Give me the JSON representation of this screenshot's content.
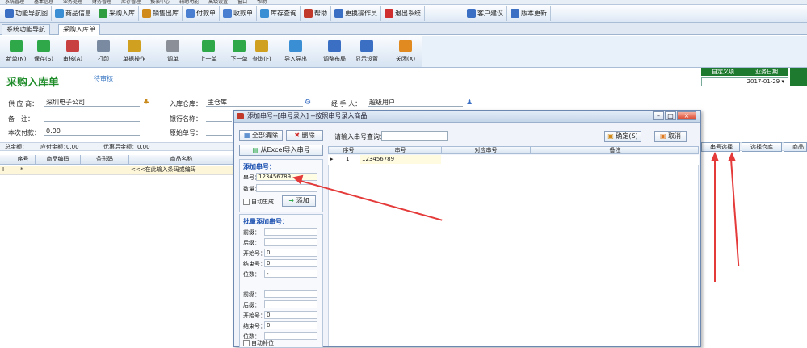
{
  "menubar": {
    "items": [
      "系统管理",
      "基本信息",
      "业务处理",
      "财务管理",
      "库存管理",
      "报表中心",
      "辅助功能",
      "高级设置",
      "窗口",
      "帮助"
    ]
  },
  "quickbar": {
    "items": [
      {
        "label": "功能导航图",
        "color": "#3a6fc4",
        "icon": "navigation-icon"
      },
      {
        "label": "商品信息",
        "color": "#3a8fd4",
        "icon": "product-icon"
      },
      {
        "label": "采购入库",
        "color": "#2f9e41",
        "icon": "purchase-icon"
      },
      {
        "label": "销售出库",
        "color": "#d08a1a",
        "icon": "sales-icon"
      },
      {
        "label": "付款单",
        "color": "#4a7ed0",
        "icon": "payment-icon"
      },
      {
        "label": "收款单",
        "color": "#4a7ed0",
        "icon": "receipt-icon"
      },
      {
        "label": "库存查询",
        "color": "#3a8fd4",
        "icon": "inventory-icon"
      },
      {
        "label": "帮助",
        "color": "#c0392b",
        "icon": "help-icon"
      },
      {
        "label": "更换操作员",
        "color": "#3a6fc4",
        "icon": "switch-user-icon"
      },
      {
        "label": "退出系统",
        "color": "#d02f2f",
        "icon": "exit-icon"
      },
      {
        "label": "客户建议",
        "color": "#3a6fc4",
        "icon": "feedback-icon"
      },
      {
        "label": "版本更新",
        "color": "#3a6fc4",
        "icon": "update-icon"
      }
    ]
  },
  "tabs": [
    {
      "label": "系统功能导航"
    },
    {
      "label": "采购入库单"
    }
  ],
  "toolbar": {
    "buttons": [
      {
        "label": "新单(N)",
        "color": "#2fa84a",
        "icon": "new-icon"
      },
      {
        "label": "保存(S)",
        "color": "#2fa84a",
        "icon": "save-icon"
      },
      {
        "label": "审核(A)",
        "color": "#c94040",
        "icon": "audit-icon"
      },
      {
        "label": "打印",
        "color": "#7a8aa0",
        "icon": "print-icon"
      },
      {
        "label": "单据操作",
        "color": "#d0a020",
        "icon": "doc-ops-icon"
      },
      {
        "label": "调单",
        "color": "#8a8f98",
        "icon": "pick-doc-icon"
      },
      {
        "label": "上一单",
        "color": "#2fa84a",
        "icon": "prev-icon"
      },
      {
        "label": "下一单",
        "color": "#2fa84a",
        "icon": "next-icon"
      },
      {
        "label": "查询(F)",
        "color": "#d0a020",
        "icon": "query-icon"
      },
      {
        "label": "导入导出",
        "color": "#3a8fd4",
        "icon": "import-export-icon"
      },
      {
        "label": "调整布局",
        "color": "#3a6fc4",
        "icon": "layout-icon"
      },
      {
        "label": "显示设置",
        "color": "#3a6fc4",
        "icon": "display-settings-icon"
      },
      {
        "label": "关闭(X)",
        "color": "#e08a20",
        "icon": "close-icon"
      }
    ]
  },
  "header": {
    "title": "采购入库单",
    "status": "待审核",
    "green_tabs": [
      "自定义项",
      "业务日期"
    ],
    "date_value": "2017-01-29"
  },
  "form": {
    "supplier_label": "供 应 商：",
    "supplier_value": "深圳电子公司",
    "remark_label": "备　注：",
    "remark_value": "",
    "payment_label": "本次付款：",
    "payment_value": "0.00",
    "warehouse_label": "入库仓库：",
    "warehouse_value": "主仓库",
    "bank_label": "银行名称：",
    "bank_value": "",
    "bill_label": "原始单号：",
    "bill_value": "",
    "operator_label": "经 手 人：",
    "operator_value": "超级用户"
  },
  "summary": {
    "goods_amount_label": "总金额：",
    "goods_amount": "",
    "payable_label": "应付金额：",
    "payable": "0.00",
    "tax_label": "优惠后金额：",
    "tax": "0.00"
  },
  "grid": {
    "headers": [
      "序号",
      "商品编码",
      "条形码",
      "商品名称"
    ],
    "row": {
      "marker": "I",
      "num": "*",
      "hint": "<<<在此输入条码或编码"
    }
  },
  "right_buttons": [
    "串号选择",
    "选择仓库",
    "商品"
  ],
  "dialog": {
    "title": "添加串号--[串号录入]  --按照串号录入商品",
    "clear_all": "全部清除",
    "delete": "删除",
    "import_excel": "从Excel导入串号",
    "single_add_title": "添加串号：",
    "serial_label": "串号：",
    "serial_value": "123456789",
    "qty_label": "数量：",
    "qty_value": "",
    "auto_gen_label": "自动生成",
    "add_button": "添加",
    "batch_title": "批量添加串号：",
    "batch_fields": [
      {
        "label": "前缀：",
        "value": ""
      },
      {
        "label": "后缀：",
        "value": ""
      },
      {
        "label": "开始号：",
        "value": "0"
      },
      {
        "label": "结束号：",
        "value": "0"
      },
      {
        "label": "位数：",
        "value": "-"
      }
    ],
    "batch_fields2": [
      {
        "label": "前缀：",
        "value": ""
      },
      {
        "label": "后缀：",
        "value": ""
      },
      {
        "label": "开始号：",
        "value": "0"
      },
      {
        "label": "结束号：",
        "value": "0"
      },
      {
        "label": "位数：",
        "value": ""
      }
    ],
    "batch_checkbox": "自动补位",
    "search_label": "请输入串号查询：",
    "search_value": "",
    "confirm": "确定(S)",
    "cancel": "取消",
    "grid_headers": [
      "序号",
      "串号",
      "对应串号",
      "备注"
    ],
    "grid_row": {
      "num": "1",
      "serial": "123456789"
    }
  }
}
